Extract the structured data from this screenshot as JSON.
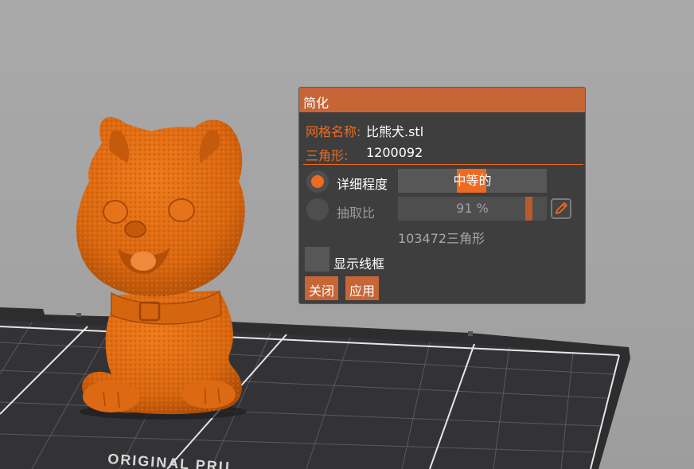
{
  "dialog": {
    "title": "简化",
    "mesh_name_label": "网格名称:",
    "mesh_name_value": "比熊犬.stl",
    "triangles_label": "三角形:",
    "triangles_value": "1200092",
    "detail_level_label": "详细程度",
    "detail_level_value": "中等的",
    "detail_level_selected": true,
    "decimate_label": "抽取比",
    "decimate_value": "91 %",
    "decimate_fraction": 0.91,
    "result_triangles": "103472三角形",
    "show_wireframe_label": "显示线框",
    "show_wireframe_checked": false,
    "close_button": "关闭",
    "apply_button": "应用"
  },
  "bed": {
    "brand_text": "ORIGINAL PRU"
  },
  "colors": {
    "accent": "#ed6b21",
    "title_bar": "#c66637",
    "panel_bg": "#3e3e3e",
    "model": "#d9660f",
    "viewport_bg": "#a6a6a6",
    "bed": "#2d2d2f"
  },
  "icons": {
    "edit": "pencil-icon"
  }
}
